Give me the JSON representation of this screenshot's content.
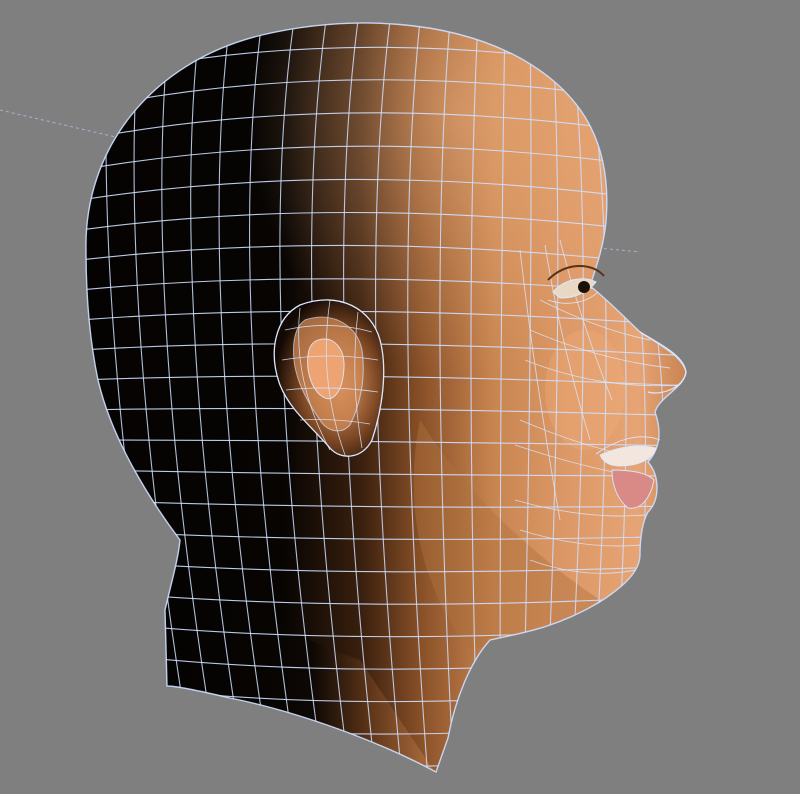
{
  "viewport": {
    "background": "#808080",
    "subject": "3d-head-model",
    "display_mode": "shaded-with-wireframe",
    "wire_color": "#cfe0ff",
    "skin_color": "#c98550",
    "shadow_color": "#050302",
    "highlight_color": "#f0b07a",
    "lip_color": "#d98a86"
  }
}
